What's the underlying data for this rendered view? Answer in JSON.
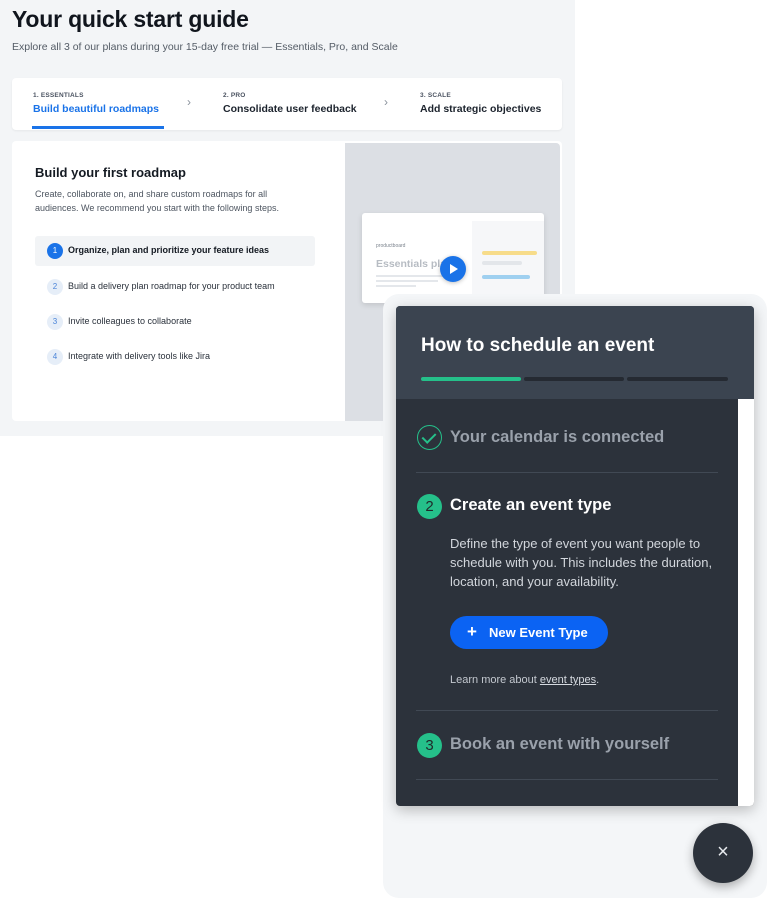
{
  "guide": {
    "title": "Your quick start guide",
    "subtitle": "Explore all 3 of our plans during your 15-day free trial — Essentials, Pro, and Scale",
    "tabs": [
      {
        "kicker": "1. ESSENTIALS",
        "label": "Build beautiful roadmaps",
        "active": true
      },
      {
        "kicker": "2. PRO",
        "label": "Consolidate user feedback",
        "active": false
      },
      {
        "kicker": "3. SCALE",
        "label": "Add strategic objectives",
        "active": false
      }
    ],
    "panel": {
      "title": "Build your first roadmap",
      "description": "Create, collaborate on, and share custom roadmaps for all audiences. We recommend you start with the following steps.",
      "steps": [
        {
          "num": "1",
          "text": "Organize, plan and prioritize your feature ideas",
          "active": true
        },
        {
          "num": "2",
          "text": "Build a delivery plan roadmap for your product team",
          "active": false
        },
        {
          "num": "3",
          "text": "Invite colleagues to collaborate",
          "active": false
        },
        {
          "num": "4",
          "text": "Integrate with delivery tools like Jira",
          "active": false
        }
      ],
      "preview": {
        "logo": "productboard",
        "heading": "Essentials plan"
      }
    }
  },
  "widget": {
    "title": "How to schedule an event",
    "progress_completed": 1,
    "progress_total": 3,
    "steps": [
      {
        "title": "Your calendar is connected",
        "status": "done"
      },
      {
        "num": "2",
        "title": "Create an event type",
        "status": "current",
        "description": "Define the type of event you want people to schedule with you. This includes the duration, location, and your availability.",
        "button_label": "New Event Type",
        "learn_prefix": "Learn more about ",
        "learn_link": "event types",
        "learn_suffix": "."
      },
      {
        "num": "3",
        "title": "Book an event with yourself",
        "status": "upcoming"
      }
    ],
    "close_symbol": "×"
  },
  "colors": {
    "accent_blue": "#1a73e8",
    "button_blue": "#0b63f3",
    "success_green": "#25c08a",
    "widget_dark": "#2c323b",
    "widget_header": "#3b4450"
  }
}
